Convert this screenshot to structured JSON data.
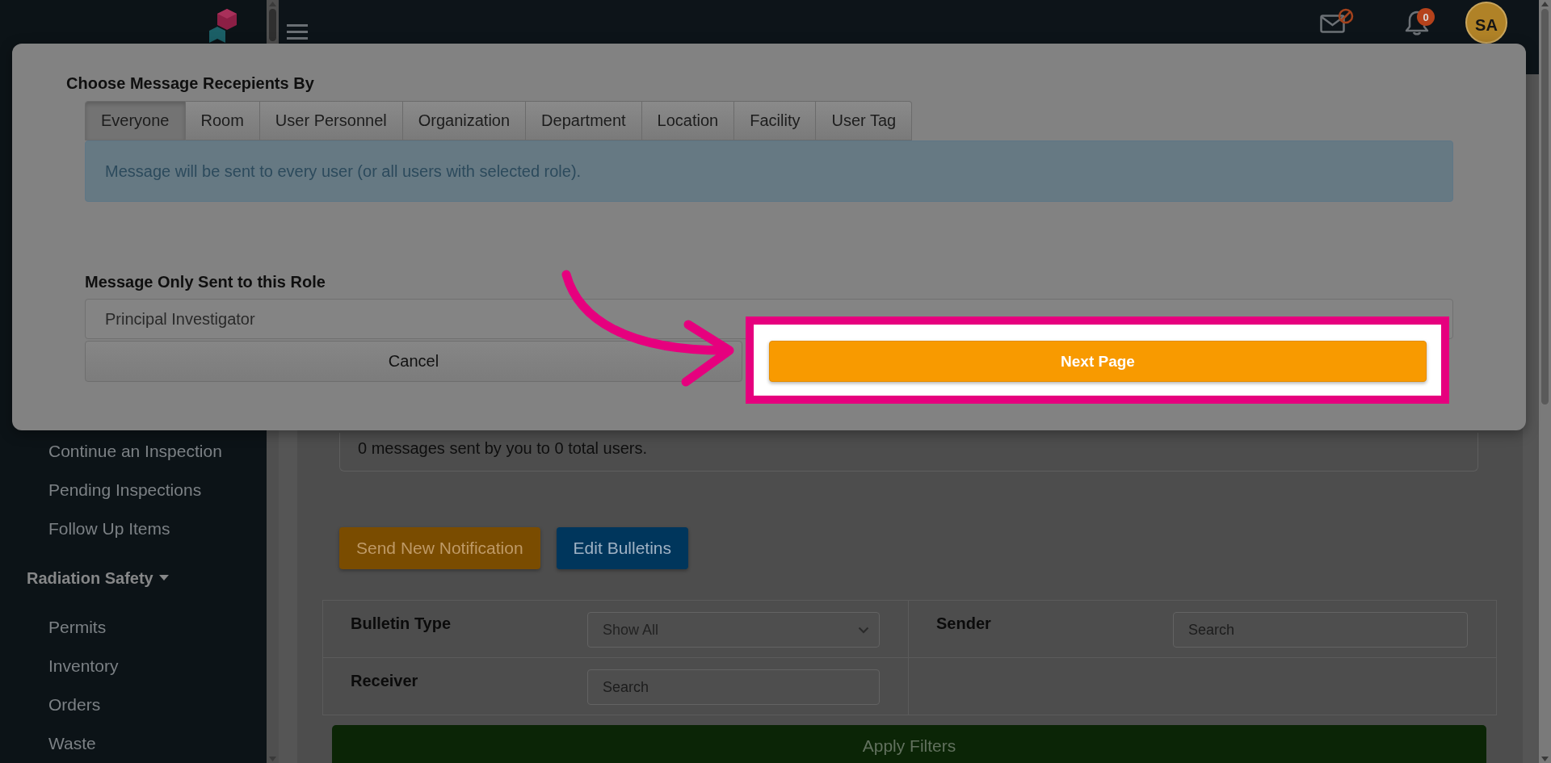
{
  "sidebar": {
    "items": [
      {
        "label": "Continue an Inspection"
      },
      {
        "label": "Pending Inspections"
      },
      {
        "label": "Follow Up Items"
      }
    ],
    "sections": [
      {
        "label": "Radiation Safety",
        "expanded": true,
        "children": [
          {
            "label": "Permits"
          },
          {
            "label": "Inventory"
          },
          {
            "label": "Orders"
          },
          {
            "label": "Waste"
          }
        ]
      }
    ]
  },
  "header": {
    "notification_count": "0",
    "avatar_initials": "SA"
  },
  "main": {
    "summary": "0 messages sent by you to 0 total users.",
    "actions": [
      {
        "label": "Send New Notification",
        "kind": "primary"
      },
      {
        "label": "Edit Bulletins",
        "kind": "secondary"
      }
    ],
    "filters": [
      {
        "label": "Bulletin Type",
        "kind": "select",
        "value": "Show All"
      },
      {
        "label": "Sender",
        "kind": "search",
        "placeholder": "Search"
      },
      {
        "label": "Receiver",
        "kind": "search",
        "placeholder": "Search"
      }
    ],
    "apply_button": "Apply Filters"
  },
  "modal": {
    "title": "Choose Message Recepients By",
    "tabs": [
      {
        "label": "Everyone",
        "selected": true
      },
      {
        "label": "Room",
        "selected": false
      },
      {
        "label": "User Personnel",
        "selected": false
      },
      {
        "label": "Organization",
        "selected": false
      },
      {
        "label": "Department",
        "selected": false
      },
      {
        "label": "Location",
        "selected": false
      },
      {
        "label": "Facility",
        "selected": false
      },
      {
        "label": "User Tag",
        "selected": false
      }
    ],
    "info": "Message will be sent to every user (or all users with selected role).",
    "role": {
      "label": "Message Only Sent to this Role",
      "value": "Principal Investigator"
    },
    "buttons": [
      {
        "label": "Cancel",
        "kind": "default",
        "highlighted": false
      },
      {
        "label": "Next Page",
        "kind": "primary",
        "highlighted": true
      }
    ]
  }
}
